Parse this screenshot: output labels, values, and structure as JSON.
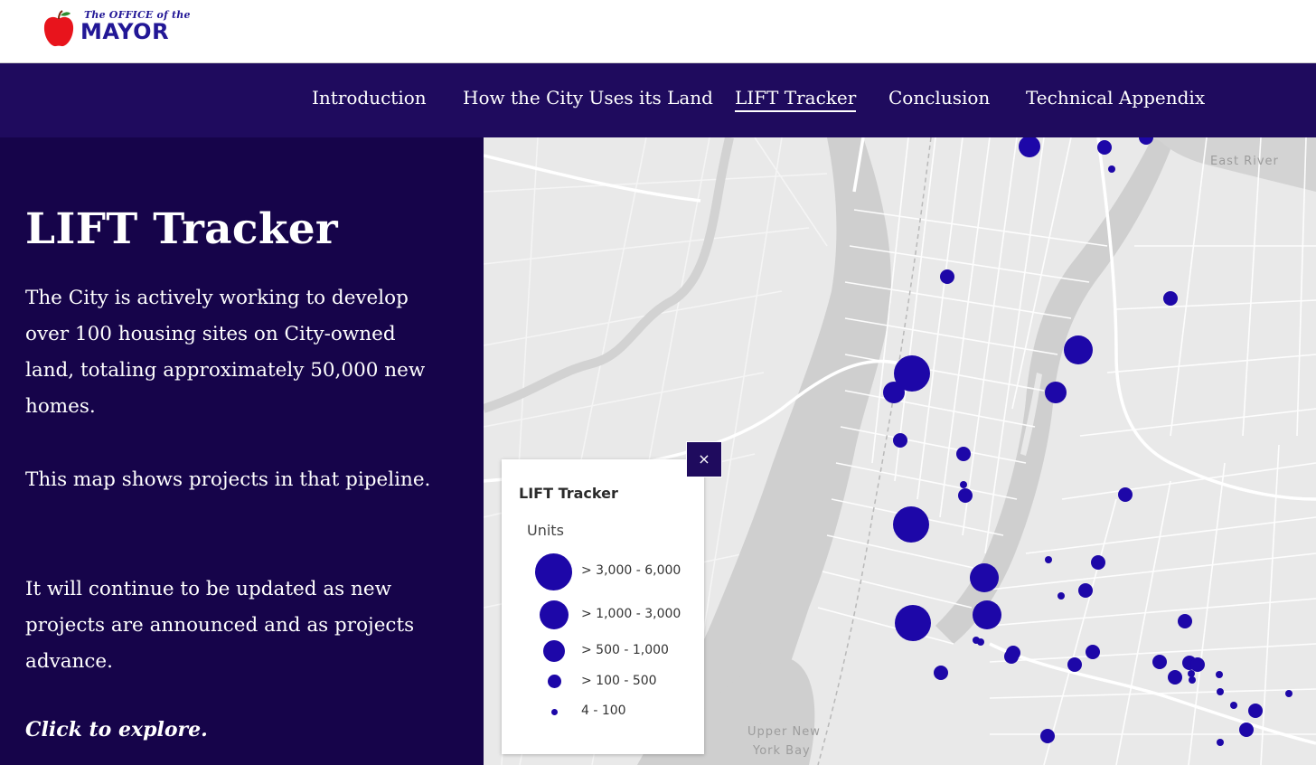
{
  "header": {
    "logo_small": "The OFFICE of the",
    "logo_big": "MAYOR"
  },
  "nav": {
    "items": [
      {
        "label": "Introduction",
        "active": false
      },
      {
        "label": "How the City Uses its Land",
        "active": false
      },
      {
        "label": "LIFT Tracker",
        "active": true
      },
      {
        "label": "Conclusion",
        "active": false
      },
      {
        "label": "Technical Appendix",
        "active": false
      }
    ]
  },
  "sidebar": {
    "title": "LIFT Tracker",
    "paragraph1": "The City is actively working to develop over 100 housing sites on City-owned land, totaling approximately 50,000 new homes.",
    "paragraph2": "This map shows projects in that pipeline.",
    "paragraph3": "It will continue to be updated as new projects are announced and as projects advance.",
    "cta": "Click to explore."
  },
  "map": {
    "labels": {
      "east_river": "East River",
      "upper_ny_bay_line1": "Upper New",
      "upper_ny_bay_line2": "York Bay"
    },
    "marker_color": "#1d07a8"
  },
  "legend": {
    "title": "LIFT Tracker",
    "subtitle": "Units",
    "close_symbol": "×",
    "classes": [
      {
        "label": "> 3,000 - 6,000"
      },
      {
        "label": "> 1,000 - 3,000"
      },
      {
        "label": "> 500 - 1,000"
      },
      {
        "label": "> 100 - 500"
      },
      {
        "label": "4 - 100"
      }
    ]
  },
  "colors": {
    "brand": "#221796",
    "nav_bg": "#1f0b5e",
    "sidebar_bg": "#16044a",
    "marker": "#1d07a8"
  }
}
